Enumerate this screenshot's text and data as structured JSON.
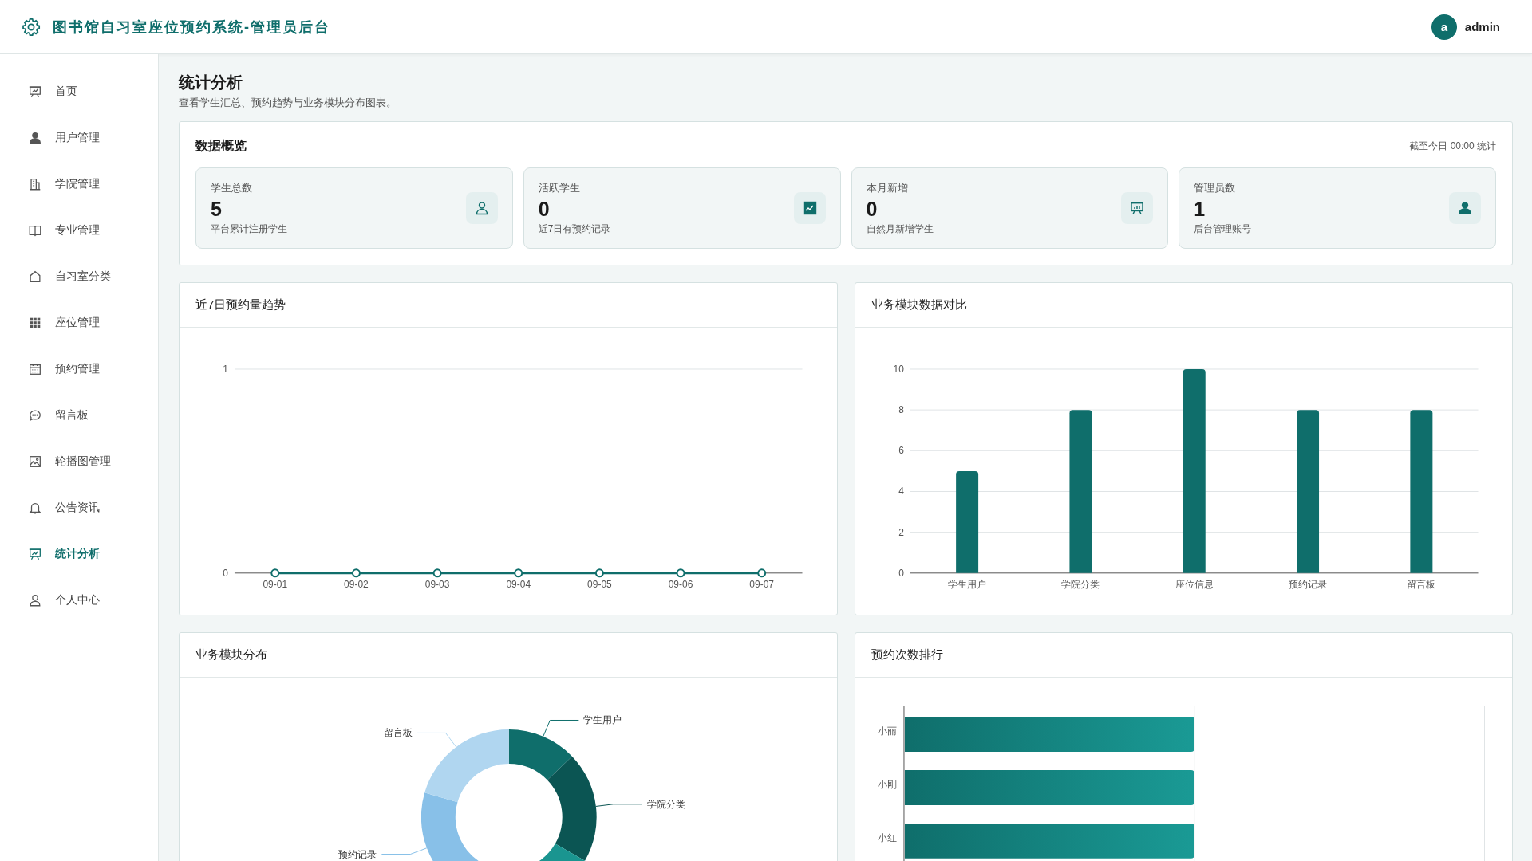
{
  "header": {
    "title": "图书馆自习室座位预约系统-管理员后台",
    "user": {
      "avatar": "a",
      "name": "admin"
    }
  },
  "sidebar": {
    "items": [
      {
        "label": "首页",
        "selected": false
      },
      {
        "label": "用户管理",
        "selected": false
      },
      {
        "label": "学院管理",
        "selected": false
      },
      {
        "label": "专业管理",
        "selected": false
      },
      {
        "label": "自习室分类",
        "selected": false
      },
      {
        "label": "座位管理",
        "selected": false
      },
      {
        "label": "预约管理",
        "selected": false
      },
      {
        "label": "留言板",
        "selected": false
      },
      {
        "label": "轮播图管理",
        "selected": false
      },
      {
        "label": "公告资讯",
        "selected": false
      },
      {
        "label": "统计分析",
        "selected": true
      },
      {
        "label": "个人中心",
        "selected": false
      }
    ]
  },
  "page": {
    "title": "统计分析",
    "subtitle": "查看学生汇总、预约趋势与业务模块分布图表。"
  },
  "overview": {
    "title": "数据概览",
    "note": "截至今日 00:00 统计",
    "cards": [
      {
        "label": "学生总数",
        "value": "5",
        "caption": "平台累计注册学生"
      },
      {
        "label": "活跃学生",
        "value": "0",
        "caption": "近7日有预约记录"
      },
      {
        "label": "本月新增",
        "value": "0",
        "caption": "自然月新增学生"
      },
      {
        "label": "管理员数",
        "value": "1",
        "caption": "后台管理账号"
      }
    ]
  },
  "trend": {
    "title": "近7日预约量趋势",
    "chart_data": {
      "type": "line",
      "categories": [
        "09-01",
        "09-02",
        "09-03",
        "09-04",
        "09-05",
        "09-06",
        "09-07"
      ],
      "values": [
        0,
        0,
        0,
        0,
        0,
        0,
        0
      ],
      "marker": true,
      "grid": true,
      "ylim": [
        0,
        1
      ],
      "yticks": [
        0,
        1
      ]
    }
  },
  "compare": {
    "title": "业务模块数据对比",
    "chart_data": {
      "type": "bar",
      "categories": [
        "学生用户",
        "学院分类",
        "座位信息",
        "预约记录",
        "留言板"
      ],
      "values": [
        5,
        8,
        10,
        8,
        8
      ],
      "grid": true,
      "ylim": [
        0,
        10
      ],
      "yticks": [
        0,
        2,
        4,
        6,
        8,
        10
      ]
    }
  },
  "distribution": {
    "title": "业务模块分布",
    "chart_data": {
      "type": "donut",
      "categories": [
        "学生用户",
        "学院分类",
        null,
        "预约记录",
        "留言板"
      ],
      "values": [
        12.8,
        20.5,
        25.7,
        20.5,
        20.5
      ]
    }
  },
  "ranking": {
    "title": "预约次数排行",
    "names": [
      "小丽",
      "小刚",
      "小红"
    ]
  }
}
